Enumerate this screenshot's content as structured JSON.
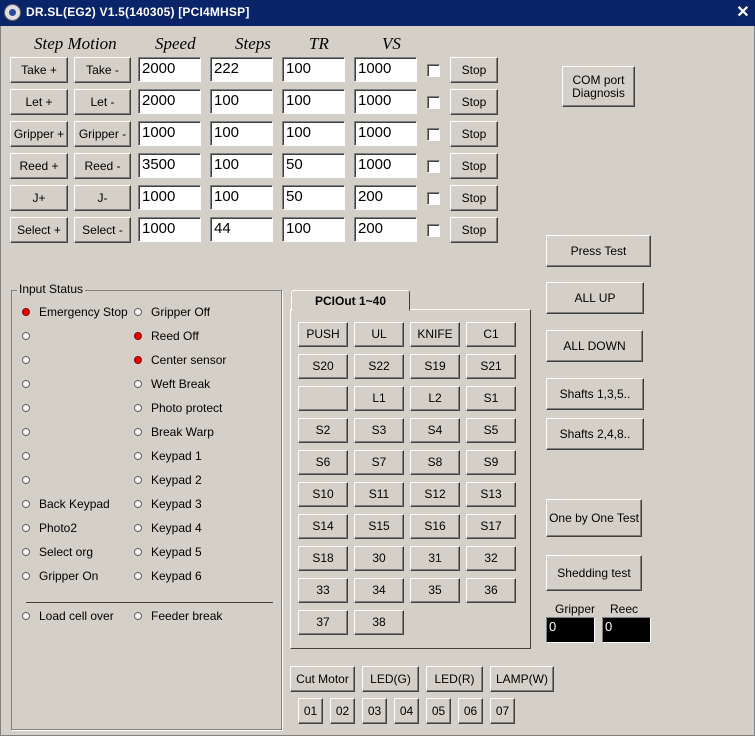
{
  "window": {
    "title": "DR.SL(EG2) V1.5(140305) [PCI4MHSP]",
    "close_glyph": "✕"
  },
  "headers": {
    "step_motion": "Step Motion",
    "speed": "Speed",
    "steps": "Steps",
    "tr": "TR",
    "vs": "VS"
  },
  "motion_rows": [
    {
      "plus": "Take +",
      "minus": "Take -",
      "speed": "2000",
      "steps": "222",
      "tr": "100",
      "vs": "1000",
      "stop": "Stop"
    },
    {
      "plus": "Let +",
      "minus": "Let -",
      "speed": "2000",
      "steps": "100",
      "tr": "100",
      "vs": "1000",
      "stop": "Stop"
    },
    {
      "plus": "Gripper +",
      "minus": "Gripper -",
      "speed": "1000",
      "steps": "100",
      "tr": "100",
      "vs": "1000",
      "stop": "Stop"
    },
    {
      "plus": "Reed +",
      "minus": "Reed -",
      "speed": "3500",
      "steps": "100",
      "tr": "50",
      "vs": "1000",
      "stop": "Stop"
    },
    {
      "plus": "J+",
      "minus": "J-",
      "speed": "1000",
      "steps": "100",
      "tr": "50",
      "vs": "200",
      "stop": "Stop"
    },
    {
      "plus": "Select +",
      "minus": "Select -",
      "speed": "1000",
      "steps": "44",
      "tr": "100",
      "vs": "200",
      "stop": "Stop"
    }
  ],
  "com_button": "COM port\nDiagnosis",
  "input_status": {
    "title": "Input Status",
    "left": [
      {
        "label": "Emergency Stop",
        "on": true
      },
      {
        "label": "",
        "on": false
      },
      {
        "label": "",
        "on": false
      },
      {
        "label": "",
        "on": false
      },
      {
        "label": "",
        "on": false
      },
      {
        "label": "",
        "on": false
      },
      {
        "label": "",
        "on": false
      },
      {
        "label": "",
        "on": false
      },
      {
        "label": "Back Keypad",
        "on": false
      },
      {
        "label": "Photo2",
        "on": false
      },
      {
        "label": "Select org",
        "on": false
      },
      {
        "label": "Gripper On",
        "on": false
      }
    ],
    "right": [
      {
        "label": "Gripper Off",
        "on": false
      },
      {
        "label": "Reed Off",
        "on": true
      },
      {
        "label": "Center sensor",
        "on": true
      },
      {
        "label": "Weft Break",
        "on": false
      },
      {
        "label": "Photo protect",
        "on": false
      },
      {
        "label": "Break Warp",
        "on": false
      },
      {
        "label": "Keypad 1",
        "on": false
      },
      {
        "label": "Keypad 2",
        "on": false
      },
      {
        "label": "Keypad 3",
        "on": false
      },
      {
        "label": "Keypad 4",
        "on": false
      },
      {
        "label": "Keypad 5",
        "on": false
      },
      {
        "label": "Keypad 6",
        "on": false
      }
    ],
    "bottom_left": {
      "label": "Load cell over",
      "on": false
    },
    "bottom_right": {
      "label": "Feeder break",
      "on": false
    }
  },
  "pci_out": {
    "tab": "PCIOut 1~40",
    "buttons": [
      "PUSH",
      "UL",
      "KNIFE",
      "C1",
      "S20",
      "S22",
      "S19",
      "S21",
      "",
      "L1",
      "L2",
      "S1",
      "S2",
      "S3",
      "S4",
      "S5",
      "S6",
      "S7",
      "S8",
      "S9",
      "S10",
      "S11",
      "S12",
      "S13",
      "S14",
      "S15",
      "S16",
      "S17",
      "S18",
      "30",
      "31",
      "32",
      "33",
      "34",
      "35",
      "36",
      "37",
      "38"
    ]
  },
  "bottom_buttons": {
    "row1": [
      "Cut Motor",
      "LED(G)",
      "LED(R)",
      "LAMP(W)"
    ],
    "row2": [
      "01",
      "02",
      "03",
      "04",
      "05",
      "06",
      "07"
    ]
  },
  "right_buttons": {
    "press_test": "Press Test",
    "all_up": "ALL UP",
    "all_down": "ALL DOWN",
    "shafts_odd": "Shafts 1,3,5..",
    "shafts_even": "Shafts 2,4,8..",
    "one_by_one": "One by One Test",
    "shedding": "Shedding test"
  },
  "readouts": {
    "gripper_label": "Gripper",
    "gripper_value": "0",
    "reed_label": "Reec",
    "reed_value": "0"
  }
}
